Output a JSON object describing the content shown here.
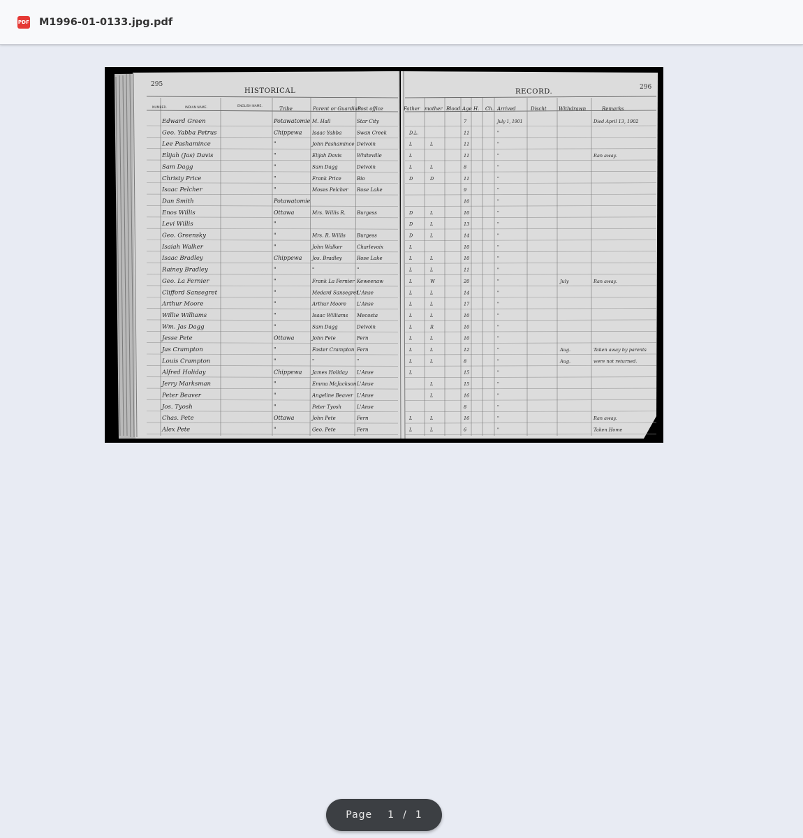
{
  "app": {
    "file_name": "M1996-01-0133.jpg.pdf",
    "file_icon": "PDF"
  },
  "pager": {
    "label": "Page",
    "current": "1",
    "separator": "/",
    "total": "1"
  },
  "document": {
    "left_page_number": "295",
    "right_page_number": "296",
    "left_heading": "HISTORICAL",
    "right_heading": "RECORD.",
    "printed_columns": [
      "NUMBER.",
      "INDIAN NAME.",
      "ENGLISH NAME."
    ],
    "handwritten_columns": [
      "Tribe",
      "Parent or Guardian",
      "Post office",
      "Father",
      "mother",
      "Blood",
      "Age",
      "H.",
      "Ch.",
      "Arrived",
      "Discht",
      "Withdrawn",
      "Remarks"
    ],
    "rows": [
      {
        "name": "Edward Green",
        "tribe": "Potawatomie",
        "parent": "M. Hall",
        "post_office": "Star City",
        "father": "",
        "mother": "",
        "blood": "",
        "age": "7",
        "arrived": "July 1, 1901",
        "withdrawn": "",
        "remarks": "Died April 13, 1902"
      },
      {
        "name": "Geo. Yabba Petrus",
        "tribe": "Chippewa",
        "parent": "Isaac Yabba",
        "post_office": "Swan Creek",
        "father": "D.L.",
        "mother": "",
        "blood": "",
        "age": "11",
        "arrived": "\"",
        "withdrawn": "",
        "remarks": ""
      },
      {
        "name": "Lee Pashamince",
        "tribe": "\"",
        "parent": "John Pashamince",
        "post_office": "Delvoin",
        "father": "L",
        "mother": "L",
        "blood": "",
        "age": "11",
        "arrived": "\"",
        "withdrawn": "",
        "remarks": ""
      },
      {
        "name": "Elijah (Jas) Davis",
        "tribe": "\"",
        "parent": "Elijah Davis",
        "post_office": "Whiteville",
        "father": "L",
        "mother": "",
        "blood": "",
        "age": "11",
        "arrived": "\"",
        "withdrawn": "",
        "remarks": "Ran away."
      },
      {
        "name": "Sam Dagg",
        "tribe": "\"",
        "parent": "Sam Dagg",
        "post_office": "Delvoin",
        "father": "L",
        "mother": "L",
        "blood": "",
        "age": "8",
        "arrived": "\"",
        "withdrawn": "",
        "remarks": ""
      },
      {
        "name": "Christy Price",
        "tribe": "\"",
        "parent": "Frank Price",
        "post_office": "Bio",
        "father": "D",
        "mother": "D",
        "blood": "",
        "age": "11",
        "arrived": "\"",
        "withdrawn": "",
        "remarks": ""
      },
      {
        "name": "Isaac Pelcher",
        "tribe": "\"",
        "parent": "Moses Pelcher",
        "post_office": "Rose Lake",
        "father": "",
        "mother": "",
        "blood": "",
        "age": "9",
        "arrived": "\"",
        "withdrawn": "",
        "remarks": ""
      },
      {
        "name": "Dan Smith",
        "tribe": "Potawatomie",
        "parent": "",
        "post_office": "",
        "father": "",
        "mother": "",
        "blood": "",
        "age": "10",
        "arrived": "\"",
        "withdrawn": "",
        "remarks": ""
      },
      {
        "name": "Enos Willis",
        "tribe": "Ottawa",
        "parent": "Mrs. Willis R.",
        "post_office": "Burgess",
        "father": "D",
        "mother": "L",
        "blood": "",
        "age": "10",
        "arrived": "\"",
        "withdrawn": "",
        "remarks": ""
      },
      {
        "name": "Levi Willis",
        "tribe": "\"",
        "parent": "",
        "post_office": "",
        "father": "D",
        "mother": "L",
        "blood": "",
        "age": "13",
        "arrived": "\"",
        "withdrawn": "",
        "remarks": ""
      },
      {
        "name": "Geo. Greensky",
        "tribe": "\"",
        "parent": "Mrs. R. Willis",
        "post_office": "Burgess",
        "father": "D",
        "mother": "L",
        "blood": "",
        "age": "14",
        "arrived": "\"",
        "withdrawn": "",
        "remarks": ""
      },
      {
        "name": "Isaiah Walker",
        "tribe": "\"",
        "parent": "John Walker",
        "post_office": "Charlevoix",
        "father": "L",
        "mother": "",
        "blood": "",
        "age": "10",
        "arrived": "\"",
        "withdrawn": "",
        "remarks": ""
      },
      {
        "name": "Isaac Bradley",
        "tribe": "Chippewa",
        "parent": "Jos. Bradley",
        "post_office": "Rose Lake",
        "father": "L",
        "mother": "L",
        "blood": "",
        "age": "10",
        "arrived": "\"",
        "withdrawn": "",
        "remarks": ""
      },
      {
        "name": "Rainey Bradley",
        "tribe": "\"",
        "parent": "\"",
        "post_office": "\"",
        "father": "L",
        "mother": "L",
        "blood": "",
        "age": "11",
        "arrived": "\"",
        "withdrawn": "",
        "remarks": ""
      },
      {
        "name": "Geo. La Fernier",
        "tribe": "\"",
        "parent": "Frank La Fernier",
        "post_office": "Keweenaw",
        "father": "L",
        "mother": "W",
        "blood": "",
        "age": "20",
        "arrived": "\"",
        "withdrawn": "July",
        "remarks": "Ran away."
      },
      {
        "name": "Clifford Sansegret",
        "tribe": "\"",
        "parent": "Medard Sansegret",
        "post_office": "L'Anse",
        "father": "L",
        "mother": "L",
        "blood": "",
        "age": "14",
        "arrived": "\"",
        "withdrawn": "",
        "remarks": ""
      },
      {
        "name": "Arthur Moore",
        "tribe": "\"",
        "parent": "Arthur Moore",
        "post_office": "L'Anse",
        "father": "L",
        "mother": "L",
        "blood": "",
        "age": "17",
        "arrived": "\"",
        "withdrawn": "",
        "remarks": ""
      },
      {
        "name": "Willie Williams",
        "tribe": "\"",
        "parent": "Isaac Williams",
        "post_office": "Mecosta",
        "father": "L",
        "mother": "L",
        "blood": "",
        "age": "10",
        "arrived": "\"",
        "withdrawn": "",
        "remarks": ""
      },
      {
        "name": "Wm. Jas Dagg",
        "tribe": "\"",
        "parent": "Sam Dagg",
        "post_office": "Delvoin",
        "father": "L",
        "mother": "R",
        "blood": "",
        "age": "10",
        "arrived": "\"",
        "withdrawn": "",
        "remarks": ""
      },
      {
        "name": "Jesse Pete",
        "tribe": "Ottawa",
        "parent": "John Pete",
        "post_office": "Fern",
        "father": "L",
        "mother": "L",
        "blood": "",
        "age": "10",
        "arrived": "\"",
        "withdrawn": "",
        "remarks": ""
      },
      {
        "name": "Jas Crampton",
        "tribe": "\"",
        "parent": "Foster Crampton",
        "post_office": "Fern",
        "father": "L",
        "mother": "L",
        "blood": "",
        "age": "12",
        "arrived": "\"",
        "withdrawn": "Aug.",
        "remarks": "Taken away by parents"
      },
      {
        "name": "Louis Crampton",
        "tribe": "\"",
        "parent": "\"",
        "post_office": "\"",
        "father": "L",
        "mother": "L",
        "blood": "",
        "age": "8",
        "arrived": "\"",
        "withdrawn": "Aug.",
        "remarks": "were not returned."
      },
      {
        "name": "Alfred Holiday",
        "tribe": "Chippewa",
        "parent": "James Holiday",
        "post_office": "L'Anse",
        "father": "L",
        "mother": "",
        "blood": "",
        "age": "15",
        "arrived": "\"",
        "withdrawn": "",
        "remarks": ""
      },
      {
        "name": "Jerry Marksman",
        "tribe": "\"",
        "parent": "Emma McJackson",
        "post_office": "L'Anse",
        "father": "",
        "mother": "L",
        "blood": "",
        "age": "15",
        "arrived": "\"",
        "withdrawn": "",
        "remarks": ""
      },
      {
        "name": "Peter Beaver",
        "tribe": "\"",
        "parent": "Angeline Beaver",
        "post_office": "L'Anse",
        "father": "",
        "mother": "L",
        "blood": "",
        "age": "16",
        "arrived": "\"",
        "withdrawn": "",
        "remarks": ""
      },
      {
        "name": "Jos. Tyosh",
        "tribe": "\"",
        "parent": "Peter Tyosh",
        "post_office": "L'Anse",
        "father": "",
        "mother": "",
        "blood": "",
        "age": "8",
        "arrived": "\"",
        "withdrawn": "",
        "remarks": ""
      },
      {
        "name": "Chas. Pete",
        "tribe": "Ottawa",
        "parent": "John Pete",
        "post_office": "Fern",
        "father": "L",
        "mother": "L",
        "blood": "",
        "age": "16",
        "arrived": "\"",
        "withdrawn": "",
        "remarks": "Ran away."
      },
      {
        "name": "Alex Pete",
        "tribe": "\"",
        "parent": "Geo. Pete",
        "post_office": "Fern",
        "father": "L",
        "mother": "L",
        "blood": "",
        "age": "6",
        "arrived": "\"",
        "withdrawn": "",
        "remarks": "Taken Home"
      }
    ]
  }
}
